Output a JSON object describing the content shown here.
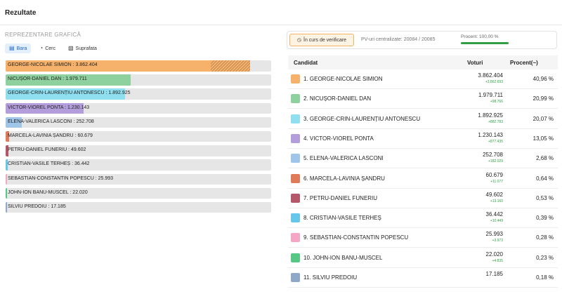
{
  "header": {
    "title": "Rezultate"
  },
  "chart_panel": {
    "subtitle": "REPREZENTARE GRAFICĂ",
    "tabs": [
      {
        "label": "Bara",
        "icon": "bar-chart-icon",
        "active": true
      },
      {
        "label": "Cerc",
        "icon": "pie-chart-icon",
        "active": false
      },
      {
        "label": "Suprafata",
        "icon": "area-chart-icon",
        "active": false
      }
    ]
  },
  "status_bar": {
    "verification_label": "În curs de verificare",
    "pv_text": "PV-uri centralizate: 20084 / 20085",
    "progress_text": "Procent: 100,00 %",
    "progress_value": 100
  },
  "table": {
    "headers": {
      "candidate": "Candidat",
      "votes": "Voturi",
      "percent": "Procent(~)"
    }
  },
  "chart_data": {
    "type": "bar",
    "orientation": "horizontal",
    "categories": [
      "GEORGE-NICOLAE SIMION",
      "NICUȘOR-DANIEL DAN",
      "GEORGE-CRIN-LAURENȚIU ANTONESCU",
      "VICTOR-VIOREL PONTA",
      "ELENA-VALERICA LASCONI",
      "MARCELA-LAVINIA ȘANDRU",
      "PETRU-DANIEL FUNERIU",
      "CRISTIAN-VASILE TERHEȘ",
      "SEBASTIAN-CONSTANTIN POPESCU",
      "JOHN-ION BANU-MUSCEL",
      "SILVIU PREDOIU"
    ],
    "values": [
      3862404,
      1979711,
      1892925,
      1230143,
      252708,
      60679,
      49602,
      36442,
      25993,
      22020,
      17185
    ],
    "bar_labels": [
      "GEORGE-NICOLAE SIMION : 3.862.404",
      "NICUȘOR-DANIEL DAN : 1.979.711",
      "GEORGE-CRIN-LAURENȚIU ANTONESCU : 1.892.925",
      "VICTOR-VIOREL PONTA : 1.230.143",
      "ELENA-VALERICA LASCONI : 252.708",
      "MARCELA-LAVINIA ȘANDRU : 60.679",
      "PETRU-DANIEL FUNERIU : 49.602",
      "CRISTIAN-VASILE TERHEȘ : 36.442",
      "SEBASTIAN-CONSTANTIN POPESCU : 25.993",
      "JOHN-ION BANU-MUSCEL : 22.020",
      "SILVIU PREDOIU : 17.185"
    ],
    "colors": [
      "#f6b26b",
      "#8fd19e",
      "#8fdff0",
      "#b39ddb",
      "#9fc5e8",
      "#e07b5a",
      "#b5576b",
      "#66c7ea",
      "#f4a6c4",
      "#57c785",
      "#8fa8c8"
    ],
    "xlim": [
      0,
      4200000
    ]
  },
  "rows": [
    {
      "name": "1. GEORGE-NICOLAE SIMION",
      "votes": "3.862.404",
      "delta": "+3.862.693",
      "percent": "40,96 %"
    },
    {
      "name": "2. NICUȘOR-DANIEL DAN",
      "votes": "1.979.711",
      "delta": "+98.766",
      "percent": "20,99 %"
    },
    {
      "name": "3. GEORGE-CRIN-LAURENȚIU ANTONESCU",
      "votes": "1.892.925",
      "delta": "+882.783",
      "percent": "20,07 %"
    },
    {
      "name": "4. VICTOR-VIOREL PONTA",
      "votes": "1.230.143",
      "delta": "+877.435",
      "percent": "13,05 %"
    },
    {
      "name": "5. ELENA-VALERICA LASCONI",
      "votes": "252.708",
      "delta": "+182.029",
      "percent": "2,68 %"
    },
    {
      "name": "6. MARCELA-LAVINIA ȘANDRU",
      "votes": "60.679",
      "delta": "+11.077",
      "percent": "0,64 %"
    },
    {
      "name": "7. PETRU-DANIEL FUNERIU",
      "votes": "49.602",
      "delta": "+13.160",
      "percent": "0,53 %"
    },
    {
      "name": "8. CRISTIAN-VASILE TERHEȘ",
      "votes": "36.442",
      "delta": "+10.449",
      "percent": "0,39 %"
    },
    {
      "name": "9. SEBASTIAN-CONSTANTIN POPESCU",
      "votes": "25.993",
      "delta": "+3.973",
      "percent": "0,28 %"
    },
    {
      "name": "10. JOHN-ION BANU-MUSCEL",
      "votes": "22.020",
      "delta": "+4.835",
      "percent": "0,23 %"
    },
    {
      "name": "11. SILVIU PREDOIU",
      "votes": "17.185",
      "delta": "",
      "percent": "0,18 %"
    }
  ]
}
